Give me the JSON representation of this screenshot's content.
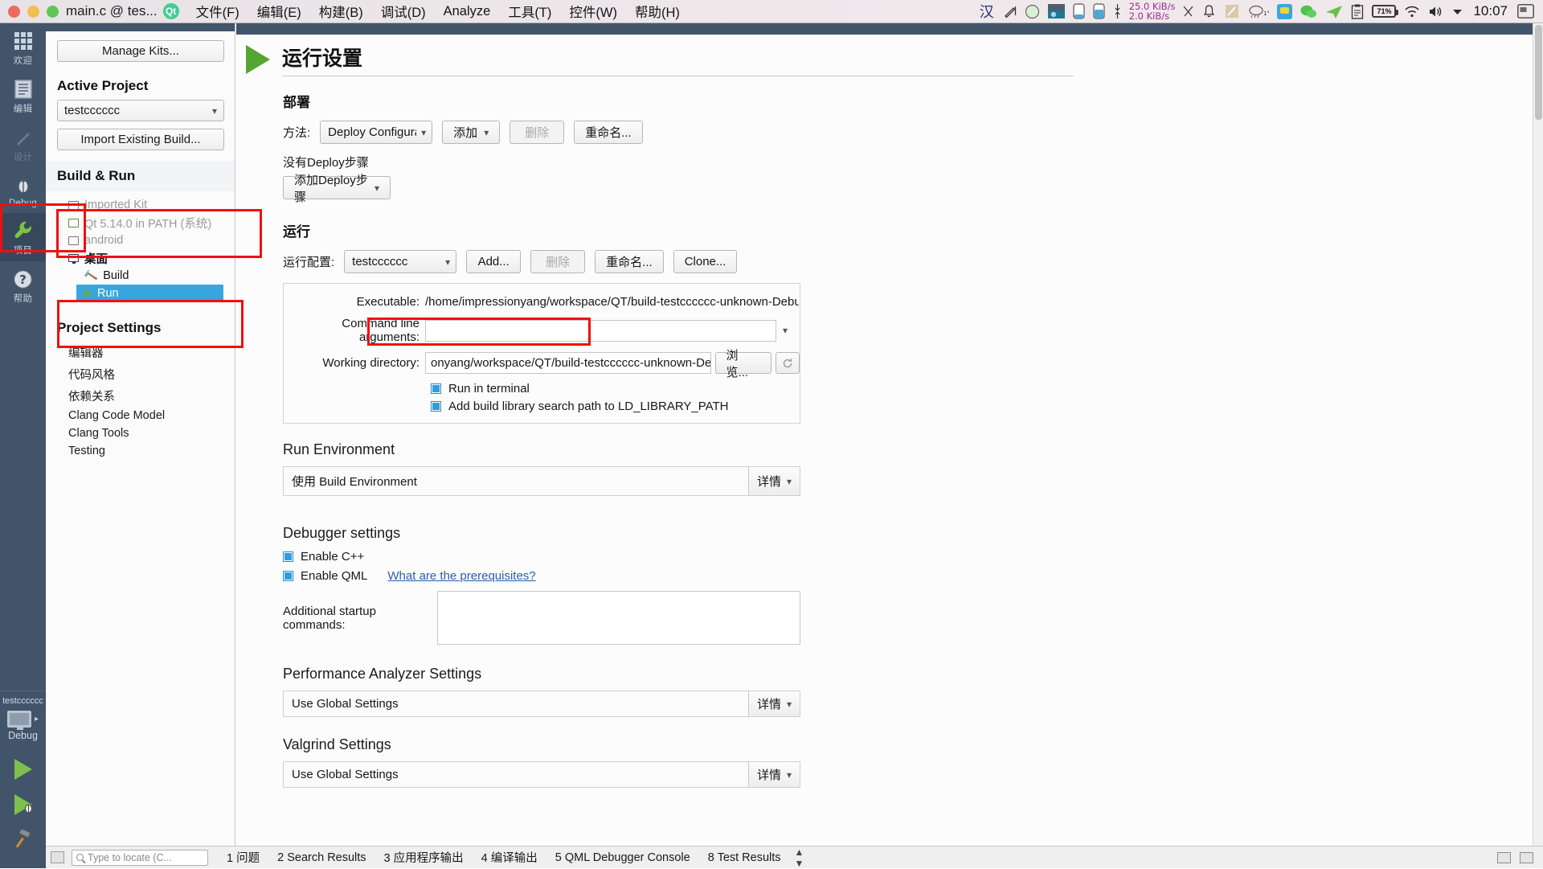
{
  "titlebar": {
    "window_title": "main.c @ tes...",
    "app_logo": "Qt",
    "menus": [
      {
        "label": "文件(F)"
      },
      {
        "label": "编辑(E)"
      },
      {
        "label": "构建(B)"
      },
      {
        "label": "调试(D)"
      },
      {
        "label": "Analyze"
      },
      {
        "label": "工具(T)"
      },
      {
        "label": "控件(W)"
      },
      {
        "label": "帮助(H)"
      }
    ],
    "tray": {
      "ime": "汉",
      "net_down": "25.0 KiB/s",
      "net_up": "2.0 KiB/s",
      "weather_temp": "1°",
      "battery": "71%",
      "clock": "10:07"
    }
  },
  "modebar": {
    "items": [
      {
        "label": "欢迎",
        "icon": "grid-icon",
        "state": "normal"
      },
      {
        "label": "编辑",
        "icon": "document-icon",
        "state": "normal"
      },
      {
        "label": "设计",
        "icon": "pencil-icon",
        "state": "disabled"
      },
      {
        "label": "Debug",
        "icon": "bug-icon",
        "state": "normal"
      },
      {
        "label": "项目",
        "icon": "wrench-icon",
        "state": "active"
      },
      {
        "label": "帮助",
        "icon": "question-icon",
        "state": "normal"
      }
    ],
    "kit_selector": {
      "project": "testcccccc",
      "build_config": "Debug",
      "icons": [
        "monitor-icon",
        "run-icon",
        "debug-icon",
        "build-icon"
      ]
    }
  },
  "project_pane": {
    "manage_kits_label": "Manage Kits...",
    "active_project_header": "Active Project",
    "active_project_value": "testcccccc",
    "import_existing_label": "Import Existing Build...",
    "build_run_header": "Build & Run",
    "kits": [
      {
        "label": "Imported Kit",
        "icon": "kit-warning-icon",
        "state": "dimmed",
        "level": 1
      },
      {
        "label": "Qt 5.14.0 in PATH (系统)",
        "icon": "kit-ok-icon",
        "state": "dimmed",
        "level": 1
      },
      {
        "label": "android",
        "icon": "kit-android-icon",
        "state": "dimmed",
        "level": 1
      },
      {
        "label": "桌面",
        "icon": "monitor-icon",
        "state": "bold",
        "level": 1
      },
      {
        "label": "Build",
        "icon": "hammer-icon",
        "state": "normal",
        "level": 2
      },
      {
        "label": "Run",
        "icon": "run-icon",
        "state": "selected",
        "level": 2
      }
    ],
    "project_settings_header": "Project Settings",
    "settings": [
      {
        "label": "编辑器"
      },
      {
        "label": "代码风格"
      },
      {
        "label": "依赖关系"
      },
      {
        "label": "Clang Code Model"
      },
      {
        "label": "Clang Tools"
      },
      {
        "label": "Testing"
      }
    ]
  },
  "main": {
    "page_title": "运行设置",
    "deploy": {
      "heading": "部署",
      "method_label": "方法:",
      "method_value": "Deploy Configuratio",
      "add_label": "添加",
      "remove_label": "删除",
      "rename_label": "重命名...",
      "no_steps_text": "没有Deploy步骤",
      "add_step_label": "添加Deploy步骤"
    },
    "run": {
      "heading": "运行",
      "config_label": "运行配置:",
      "config_value": "testcccccc",
      "add_label": "Add...",
      "remove_label": "删除",
      "rename_label": "重命名...",
      "clone_label": "Clone...",
      "executable_label": "Executable:",
      "executable_value": "/home/impressionyang/workspace/QT/build-testcccccc-unknown-Debug/te",
      "cmdline_label": "Command line arguments:",
      "cmdline_value": "",
      "workdir_label": "Working directory:",
      "workdir_value": "onyang/workspace/QT/build-testcccccc-unknown-Debug",
      "browse_label": "浏览...",
      "run_in_terminal_label": "Run in terminal",
      "run_in_terminal_checked": true,
      "add_lib_path_label": "Add build library search path to LD_LIBRARY_PATH",
      "add_lib_path_checked": true
    },
    "run_environment": {
      "heading": "Run Environment",
      "value": "使用 Build Environment",
      "details_label": "详情"
    },
    "debugger": {
      "heading": "Debugger settings",
      "enable_cpp_label": "Enable C++",
      "enable_cpp_checked": true,
      "enable_qml_label": "Enable QML",
      "enable_qml_checked": true,
      "prerequisites_link": "What are the prerequisites?",
      "startup_label": "Additional startup commands:",
      "startup_value": ""
    },
    "performance": {
      "heading": "Performance Analyzer Settings",
      "value": "Use Global Settings",
      "details_label": "详情"
    },
    "valgrind": {
      "heading": "Valgrind Settings",
      "value": "Use Global Settings",
      "details_label": "详情"
    }
  },
  "statusbar": {
    "locator_placeholder": "Type to locate (C...",
    "panes": [
      {
        "num": "1",
        "label": "问题"
      },
      {
        "num": "2",
        "label": "Search Results"
      },
      {
        "num": "3",
        "label": "应用程序输出"
      },
      {
        "num": "4",
        "label": "编译输出"
      },
      {
        "num": "5",
        "label": "QML Debugger Console"
      },
      {
        "num": "8",
        "label": "Test Results"
      }
    ]
  },
  "colors": {
    "modebar_bg": "#41546a",
    "selection_blue": "#39a5dd",
    "annotation_red": "#f01010",
    "run_green": "#55a532"
  }
}
